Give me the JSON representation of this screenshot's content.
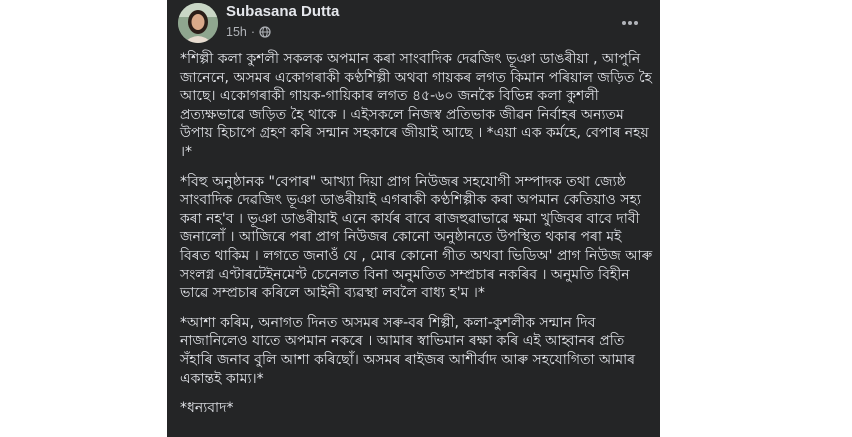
{
  "post": {
    "author": "Subasana Dutta",
    "time": "15h",
    "separator": "·",
    "paragraphs": [
      "*শিল্পী কলা কুশলী সকলক অপমান কৰা সাংবাদিক দেৱজিৎ ভূঞা ডাঙৰীয়া , আপুনি জানেনে, অসমৰ একোগৰাকী কণ্ঠশিল্পী অথবা গায়কৰ লগত কিমান পৰিয়াল জড়িত হৈ আছে। একোগৰাকী গায়ক-গায়িকাৰ লগত ৪৫-৬০ জনকৈ বিভিন্ন কলা কুশলী প্ৰত্যক্ষভাৱে জড়িত হৈ থাকে । এইসকলে নিজস্ব প্ৰতিভাক জীৱন নিৰ্বাহৰ অন্যতম উপায় হিচাপে গ্ৰহণ কৰি সন্মান সহকাৰে জীয়াই আছে । *এয়া এক কৰ্মহে, বেপাৰ নহয় ।*",
      "*বিহু অনুষ্ঠানক \"বেপাৰ\" আখ্যা দিয়া প্ৰাগ নিউজৰ সহযোগী সম্পাদক তথা জ্যেষ্ঠ সাংবাদিক দেৱজিৎ ভূঞা ডাঙৰীয়াই এগৰাকী কণ্ঠশিল্পীক কৰা অপমান কেতিয়াও সহ্য কৰা নহ'ব । ভূঞা ডাঙৰীয়াই এনে কাৰ্যৰ বাবে ৰাজহুৱাভাৱে ক্ষমা খুজিবৰ বাবে দাবী জনালোঁ । আজিৰে পৰা প্ৰাগ নিউজৰ কোনো অনুষ্ঠানতে উপস্থিত থকাৰ পৰা মই বিৰত থাকিম । লগতে জনাওঁ যে , মোৰ কোনো গীত অথবা ভিডিঅ' প্ৰাগ নিউজ আৰু সংলগ্ন এণ্টাৰটেইনমেণ্ট চেনেলত বিনা অনুমতিত সম্প্ৰচাৰ নকৰিব । অনুমতি বিহীন ভাৱে সম্প্ৰচাৰ কৰিলে আইনী ব্যৱস্থা লবলৈ বাধ্য হ'ম ।*",
      "*আশা কৰিম, অনাগত দিনত অসমৰ সৰু-বৰ শিল্পী, কলা-কুশলীক সন্মান দিব নাজানিলেও যাতে অপমান নকৰে । আমাৰ স্বাভিমান ৰক্ষা কৰি এই আহ্বানৰ প্ৰতি সঁহাৰি জনাব বুলি আশা কৰিছোঁ। অসমৰ ৰাইজৰ আশীৰ্বাদ আৰু সহযোগিতা আমাৰ একান্তই কাম্য।*",
      "*ধন্যবাদ*"
    ]
  },
  "colors": {
    "card_bg": "#242526",
    "text": "#e4e6eb",
    "secondary_text": "#b0b3b8",
    "page_bg": "#ffffff"
  },
  "icons": [
    "avatar",
    "globe-icon",
    "more-options-icon"
  ]
}
